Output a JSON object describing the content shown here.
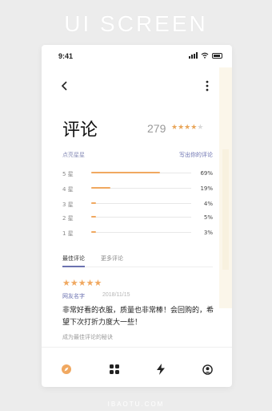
{
  "banner": "UI SCREEN",
  "watermark": "IBAOTU.COM",
  "status_bar": {
    "time": "9:41"
  },
  "header": {
    "back_icon": "chevron-left-icon",
    "more_icon": "more-vertical-icon"
  },
  "page": {
    "title": "评论"
  },
  "rating": {
    "score": "279",
    "stars_filled": 4,
    "stars_total": 5
  },
  "actions": {
    "rate_label": "点亮星星",
    "write_review": "写出你的评论"
  },
  "distribution": [
    {
      "label": "5 星",
      "percent_text": "69%",
      "value": 69
    },
    {
      "label": "4 星",
      "percent_text": "19%",
      "value": 19
    },
    {
      "label": "3 星",
      "percent_text": "4%",
      "value": 4
    },
    {
      "label": "2 星",
      "percent_text": "5%",
      "value": 5
    },
    {
      "label": "1 星",
      "percent_text": "3%",
      "value": 3
    }
  ],
  "tabs": [
    {
      "label": "最佳评论",
      "active": true
    },
    {
      "label": "更多评论",
      "active": false
    }
  ],
  "review": {
    "stars": 5,
    "author": "网友名字",
    "date": "2018/11/15",
    "text": "非常好看的衣服，质量也非常棒！会回购的，希望下次打折力度大一些！",
    "tip": "成为最佳评论的秘诀"
  },
  "tabbar": [
    {
      "icon": "compass-icon",
      "active": true
    },
    {
      "icon": "grid-icon",
      "active": false
    },
    {
      "icon": "lightning-icon",
      "active": false
    },
    {
      "icon": "profile-icon",
      "active": false
    }
  ],
  "colors": {
    "accent": "#f0a860",
    "link": "#6b72b0",
    "text": "#222222"
  }
}
